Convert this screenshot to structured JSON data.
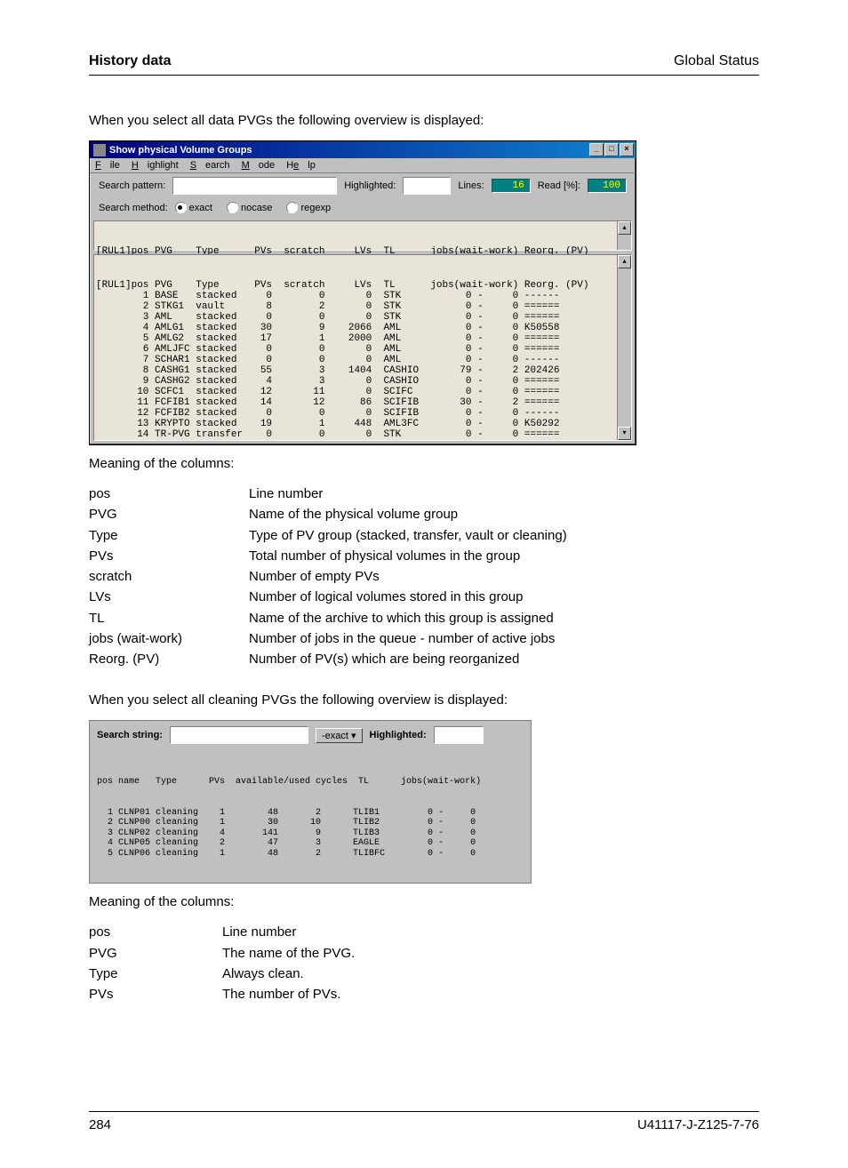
{
  "header": {
    "left": "History data",
    "right": "Global Status"
  },
  "intro1": "When you select all data PVGs the following overview is displayed:",
  "win1": {
    "title": "Show physical Volume Groups",
    "menu": {
      "file": "File",
      "highlight": "Highlight",
      "search": "Search",
      "mode": "Mode",
      "help": "Help"
    },
    "search_pattern_label": "Search pattern:",
    "search_pattern_value": "",
    "highlighted_label": "Highlighted:",
    "highlighted_value": "",
    "lines_label": "Lines:",
    "lines_value": "16",
    "read_label": "Read [%]:",
    "read_value": "100",
    "search_method_label": "Search method:",
    "radios": {
      "exact": "exact",
      "nocase": "nocase",
      "regexp": "regexp"
    },
    "header_line": "[RUL1]pos PVG    Type      PVs  scratch     LVs  TL      jobs(wait-work) Reorg. (PV)",
    "rows": [
      "[RUL1]pos PVG    Type      PVs  scratch     LVs  TL      jobs(wait-work) Reorg. (PV)",
      "        1 BASE   stacked     0        0       0  STK           0 -     0 ------",
      "        2 STKG1  vault       8        2       0  STK           0 -     0 ======",
      "        3 AML    stacked     0        0       0  STK           0 -     0 ======",
      "        4 AMLG1  stacked    30        9    2066  AML           0 -     0 K50558",
      "        5 AMLG2  stacked    17        1    2000  AML           0 -     0 ======",
      "        6 AMLJFC stacked     0        0       0  AML           0 -     0 ======",
      "        7 SCHAR1 stacked     0        0       0  AML           0 -     0 ------",
      "        8 CASHG1 stacked    55        3    1404  CASHIO       79 -     2 202426",
      "        9 CASHG2 stacked     4        3       0  CASHIO        0 -     0 ======",
      "       10 SCFC1  stacked    12       11       0  SCIFC         0 -     0 ======",
      "       11 FCFIB1 stacked    14       12      86  SCIFIB       30 -     2 ======",
      "       12 FCFIB2 stacked     0        0       0  SCIFIB        0 -     0 ------",
      "       13 KRYPTO stacked    19        1     448  AML3FC        0 -     0 K50292",
      "       14 TR-PVG transfer    0        0       0  STK           0 -     0 ======"
    ]
  },
  "meaning_label": "Meaning of the columns:",
  "defs1": [
    {
      "term": "pos",
      "desc": "Line number"
    },
    {
      "term": "PVG",
      "desc": "Name of the physical volume group"
    },
    {
      "term": "Type",
      "desc": "Type of PV group (stacked, transfer, vault or cleaning)"
    },
    {
      "term": "PVs",
      "desc": "Total number of physical volumes in the group"
    },
    {
      "term": "scratch",
      "desc": "Number of empty PVs"
    },
    {
      "term": "LVs",
      "desc": "Number of logical volumes stored in this group"
    },
    {
      "term": "TL",
      "desc": "Name of the archive to which this group is assigned"
    },
    {
      "term": "jobs (wait-work)",
      "desc": "Number of jobs in the queue - number of active jobs"
    },
    {
      "term": "Reorg. (PV)",
      "desc": "Number of PV(s) which are being reorganized"
    }
  ],
  "intro2": "When you select all cleaning PVGs the following overview is displayed:",
  "win2": {
    "search_string_label": "Search string:",
    "search_string_value": "",
    "exact_button": "-exact",
    "highlighted_label": "Highlighted:",
    "highlighted_value": "",
    "header_line": "pos name   Type      PVs  available/used cycles  TL      jobs(wait-work)",
    "rows": [
      "  1 CLNP01 cleaning    1        48       2      TLIB1         0 -     0",
      "  2 CLNP00 cleaning    1        30      10      TLIB2         0 -     0",
      "  3 CLNP02 cleaning    4       141       9      TLIB3         0 -     0",
      "  4 CLNP05 cleaning    2        47       3      EAGLE         0 -     0",
      "  5 CLNP06 cleaning    1        48       2      TLIBFC        0 -     0"
    ]
  },
  "defs2": [
    {
      "term": "pos",
      "desc": "Line number"
    },
    {
      "term": "PVG",
      "desc": "The name of the PVG."
    },
    {
      "term": "Type",
      "desc": "Always clean."
    },
    {
      "term": "PVs",
      "desc": "The number of PVs."
    }
  ],
  "footer": {
    "left": "284",
    "right": "U41117-J-Z125-7-76"
  }
}
